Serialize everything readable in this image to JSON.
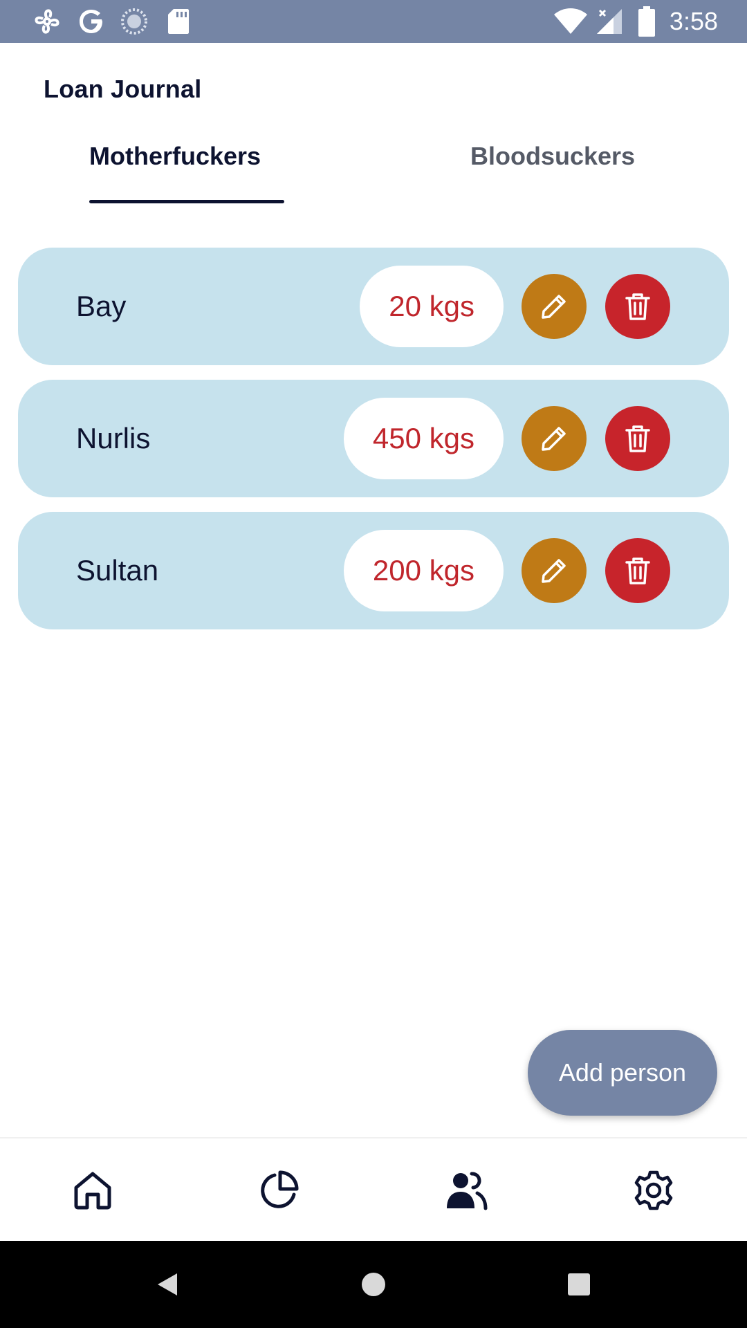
{
  "status_bar": {
    "time": "3:58",
    "left_icons": [
      "fan-icon",
      "google-icon",
      "sync-icon",
      "sd-card-icon"
    ],
    "right_icons": [
      "wifi-icon",
      "signal-icon",
      "battery-icon"
    ]
  },
  "app": {
    "title": "Loan Journal"
  },
  "tabs": [
    {
      "label": "Motherfuckers",
      "active": true
    },
    {
      "label": "Bloodsuckers",
      "active": false
    }
  ],
  "people": [
    {
      "name": "Bay",
      "amount": "20 kgs"
    },
    {
      "name": "Nurlis",
      "amount": "450 kgs"
    },
    {
      "name": "Sultan",
      "amount": "200 kgs"
    }
  ],
  "fab": {
    "label": "Add person"
  },
  "bottom_nav": {
    "items": [
      "home-icon",
      "pie-chart-icon",
      "people-icon",
      "settings-icon"
    ],
    "active": "people-icon"
  },
  "colors": {
    "status_bar": "#7585a5",
    "card": "#c6e2ed",
    "amount_text": "#c0262c",
    "edit": "#bf7a16",
    "delete": "#c7242b",
    "text_dark": "#0d1330"
  }
}
